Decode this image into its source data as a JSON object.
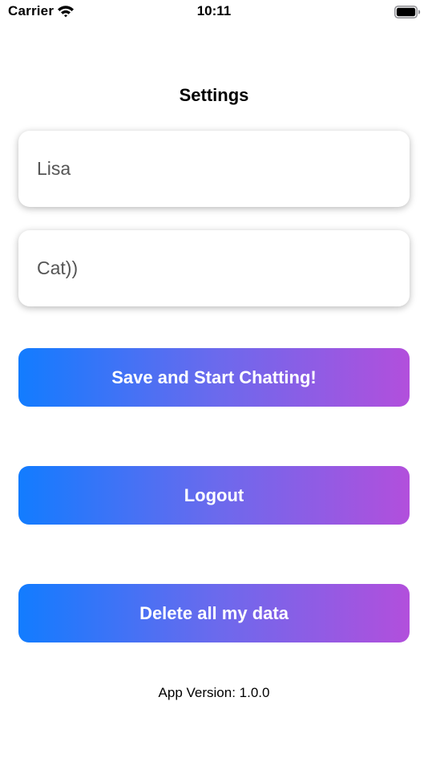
{
  "status_bar": {
    "carrier": "Carrier",
    "time": "10:11",
    "wifi_icon": "wifi-icon",
    "battery_icon": "battery-icon"
  },
  "title": "Settings",
  "fields": {
    "name": {
      "value": "Lisa"
    },
    "pet": {
      "value": "Cat))"
    }
  },
  "buttons": {
    "save": "Save and Start Chatting!",
    "logout": "Logout",
    "delete": "Delete all my data"
  },
  "version": "App Version: 1.0.0",
  "colors": {
    "gradient_start": "#127cff",
    "gradient_end": "#b24fdc"
  }
}
